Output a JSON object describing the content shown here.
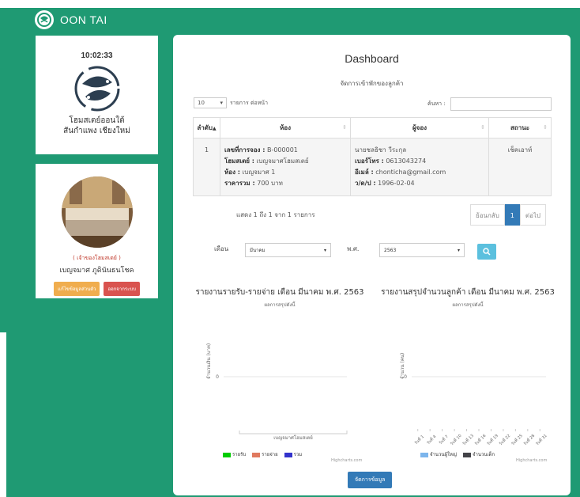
{
  "brand": "OON TAI",
  "clock": "10:02:33",
  "shop_name_line1": "โฮมสเตย์ออนใต้",
  "shop_name_line2": "สันกำแพง เชียงใหม่",
  "owner_role": "( เจ้าของโฮมสเตย์ )",
  "owner_name": "เบญจมาศ ภูดินันธนโชค",
  "edit_profile_label": "แก้ไขข้อมูลส่วนตัว",
  "logout_label": "ออกจากระบบ",
  "dashboard_title": "Dashboard",
  "dashboard_subtitle": "จัดการเข้าพักของลูกค้า",
  "page_length": "10",
  "page_length_suffix": "รายการ ต่อหน้า",
  "search_label": "ค้นหา :",
  "table_headers": [
    "ลำดับ",
    "ห้อง",
    "ผู้จอง",
    "สถานะ"
  ],
  "table_row": {
    "index": "1",
    "booking_no_label": "เลขที่การจอง :",
    "booking_no": "B-000001",
    "homestay_label": "โฮมสเตย์ :",
    "homestay": "เบญจมาศโฮมสเตย์",
    "room_label": "ห้อง :",
    "room": "เบญจมาศ 1",
    "total_label": "ราคารวม :",
    "total": "700 บาท",
    "customer_name": "นายชลธิชา วีระกุล",
    "phone_label": "เบอร์โทร :",
    "phone": "0613043274",
    "email_label": "อีเมล์ :",
    "email": "chonticha@gmail.com",
    "dob_label": "ว/ด/ป :",
    "dob": "1996-02-04",
    "status": "เช็คเอาท์"
  },
  "table_info": "แสดง 1 ถึง 1 จาก 1 รายการ",
  "pagination": {
    "prev": "ย้อนกลับ",
    "current": "1",
    "next": "ต่อไป"
  },
  "filter_month_label": "เดือน",
  "filter_month_value": "มีนาคม",
  "filter_year_label": "พ.ศ.",
  "filter_year_value": "2563",
  "manage_button": "จัดการข้อมูล",
  "chart_data": [
    {
      "type": "bar",
      "title": "รายงานรายรับ-รายจ่าย เดือน มีนาคม พ.ศ. 2563",
      "subtitle": "ผลการสรุปดังนี้",
      "ylabel": "จำนวนเงิน (บาท)",
      "categories": [
        "เบญจมาศโฮมสเตย์"
      ],
      "series": [
        {
          "name": "รายรับ",
          "values": [
            0
          ],
          "color": "#00cc00"
        },
        {
          "name": "รายจ่าย",
          "values": [
            0
          ],
          "color": "#e07a5f"
        },
        {
          "name": "รวม",
          "values": [
            0
          ],
          "color": "#3333cc"
        }
      ],
      "yticks": [
        "0"
      ],
      "credit": "Highcharts.com"
    },
    {
      "type": "bar",
      "title": "รายงานสรุปจำนวนลูกค้า เดือน มีนาคม พ.ศ. 2563",
      "subtitle": "ผลการสรุปดังนี้",
      "ylabel": "จำนวน (คน)",
      "categories": [
        "วันที่ 1",
        "วันที่ 4",
        "วันที่ 7",
        "วันที่ 10",
        "วันที่ 13",
        "วันที่ 16",
        "วันที่ 19",
        "วันที่ 22",
        "วันที่ 25",
        "วันที่ 28",
        "วันที่ 31"
      ],
      "series": [
        {
          "name": "จำนวนผู้ใหญ่",
          "values": [
            0,
            0,
            0,
            0,
            0,
            0,
            0,
            0,
            0,
            0,
            0
          ],
          "color": "#7cb5ec"
        },
        {
          "name": "จำนวนเด็ก",
          "values": [
            0,
            0,
            0,
            0,
            0,
            0,
            0,
            0,
            0,
            0,
            0
          ],
          "color": "#434348"
        }
      ],
      "yticks": [
        "0"
      ],
      "credit": "Highcharts.com"
    }
  ]
}
